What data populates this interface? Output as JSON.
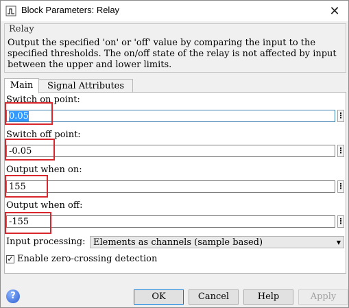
{
  "window": {
    "title": "Block Parameters: Relay",
    "close_icon": "close-icon"
  },
  "description": {
    "group_title": "Relay",
    "text": "Output the specified 'on' or 'off' value by comparing the input to the specified thresholds.  The on/off state of the relay is not affected by input between the upper and lower limits."
  },
  "tabs": [
    {
      "label": "Main",
      "active": true
    },
    {
      "label": "Signal Attributes",
      "active": false
    }
  ],
  "params": {
    "switch_on": {
      "label": "Switch on point:",
      "value": "0.05"
    },
    "switch_off": {
      "label": "Switch off point:",
      "value": "-0.05"
    },
    "output_on": {
      "label": "Output when on:",
      "value": "155"
    },
    "output_off": {
      "label": "Output when off:",
      "value": "-155"
    },
    "input_processing": {
      "label": "Input processing:",
      "value": "Elements as channels (sample based)"
    },
    "zero_crossing": {
      "label": "Enable zero-crossing detection",
      "checked": true,
      "mark": "✓"
    },
    "more_options_symbol": "⋮"
  },
  "buttons": {
    "ok": "OK",
    "cancel": "Cancel",
    "help": "Help",
    "apply": "Apply",
    "help_icon_glyph": "?"
  },
  "colors": {
    "highlight_box": "#d9262c",
    "selection": "#3399ff"
  }
}
